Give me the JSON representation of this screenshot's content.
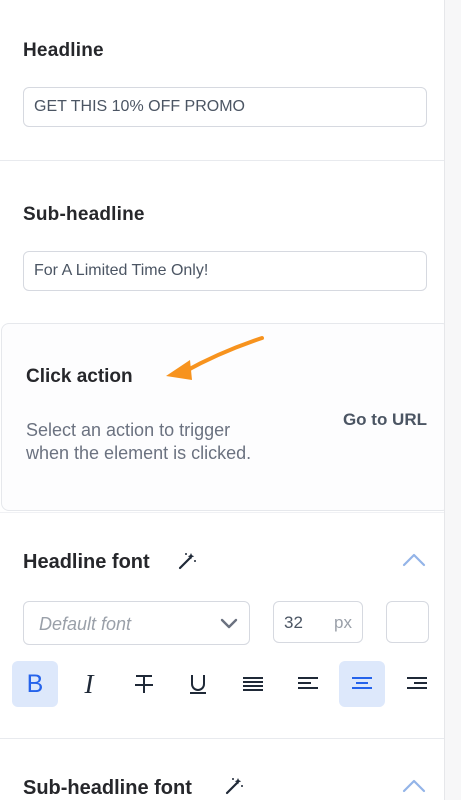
{
  "headline": {
    "label": "Headline",
    "value": "GET THIS 10% OFF PROMO"
  },
  "subheadline": {
    "label": "Sub-headline",
    "value": "For A Limited Time Only!"
  },
  "click_action": {
    "title": "Click action",
    "description": "Select an action to trigger when the element is clicked.",
    "selected": "Go to URL"
  },
  "headline_font": {
    "title": "Headline font",
    "font_placeholder": "Default font",
    "size": "32",
    "unit": "px",
    "formatting": {
      "bold": "B",
      "italic": "I"
    }
  },
  "subheadline_font": {
    "title": "Sub-headline font"
  },
  "colors": {
    "accent": "#3b82f6",
    "active_bg": "#dde8fb",
    "arrow": "#f7931e"
  }
}
